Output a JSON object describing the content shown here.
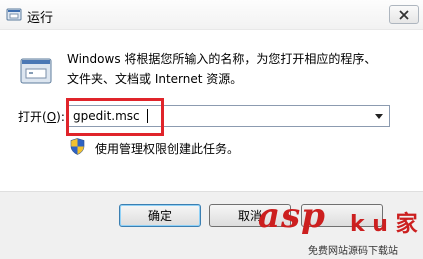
{
  "window": {
    "title": "运行"
  },
  "description": {
    "line1": "Windows 将根据您所输入的名称，为您打开相应的程序、",
    "line2": "文件夹、文档或 Internet 资源。"
  },
  "open_field": {
    "label_prefix": "打开(",
    "label_key": "O",
    "label_suffix": "):",
    "value": "gpedit.msc"
  },
  "admin_note": "使用管理权限创建此任务。",
  "buttons": {
    "ok": "确定",
    "cancel": "取消",
    "browse": ""
  },
  "watermark": {
    "logo": "asp",
    "logo_han": "k u 家",
    "caption": "免费网站源码下载站"
  },
  "icons": {
    "app": "run-dialog-icon",
    "close": "close-icon",
    "dropdown": "chevron-down-icon",
    "shield": "uac-shield-icon"
  },
  "colors": {
    "highlight": "#e0242a",
    "watermark": "#cc1f1f",
    "footer": "#f0f0f0"
  }
}
